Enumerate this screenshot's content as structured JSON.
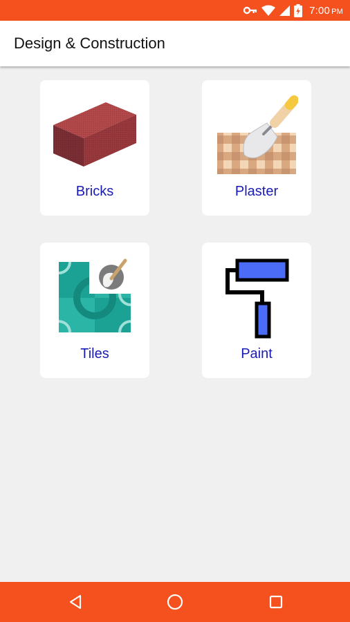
{
  "status_bar": {
    "time": "7:00",
    "time_suffix": "PM",
    "icons": [
      "vpn-key-icon",
      "wifi-icon",
      "cellular-signal-icon",
      "battery-charging-icon"
    ]
  },
  "app_bar": {
    "title": "Design & Construction"
  },
  "categories": [
    {
      "label": "Bricks",
      "icon": "brick-icon"
    },
    {
      "label": "Plaster",
      "icon": "plaster-trowel-icon"
    },
    {
      "label": "Tiles",
      "icon": "tiles-icon"
    },
    {
      "label": "Paint",
      "icon": "paint-roller-icon"
    }
  ],
  "nav_bar": {
    "buttons": [
      "back-icon",
      "home-icon",
      "recents-icon"
    ]
  },
  "colors": {
    "accent": "#f4511e",
    "card_label": "#1a1ab4",
    "background": "#f0f0f0"
  }
}
